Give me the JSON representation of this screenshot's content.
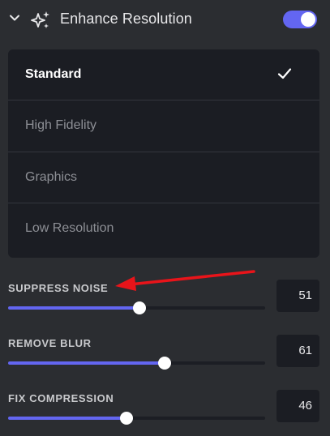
{
  "header": {
    "title": "Enhance Resolution",
    "collapse_icon": "chevron-down-icon",
    "feature_icon": "sparkles-icon",
    "toggle_enabled": true,
    "accent_color": "#6366f1"
  },
  "options": {
    "selected": "Standard",
    "items": [
      {
        "label": "Standard",
        "selected": true
      },
      {
        "label": "High Fidelity",
        "selected": false
      },
      {
        "label": "Graphics",
        "selected": false
      },
      {
        "label": "Low Resolution",
        "selected": false
      }
    ],
    "check_icon": "check-icon"
  },
  "sliders": [
    {
      "label": "SUPPRESS NOISE",
      "value": 51,
      "display": "51"
    },
    {
      "label": "REMOVE BLUR",
      "value": 61,
      "display": "61"
    },
    {
      "label": "FIX COMPRESSION",
      "value": 46,
      "display": "46"
    }
  ],
  "annotation": {
    "type": "red-arrow",
    "points_to": "SUPPRESS NOISE",
    "color": "#e8141a"
  }
}
